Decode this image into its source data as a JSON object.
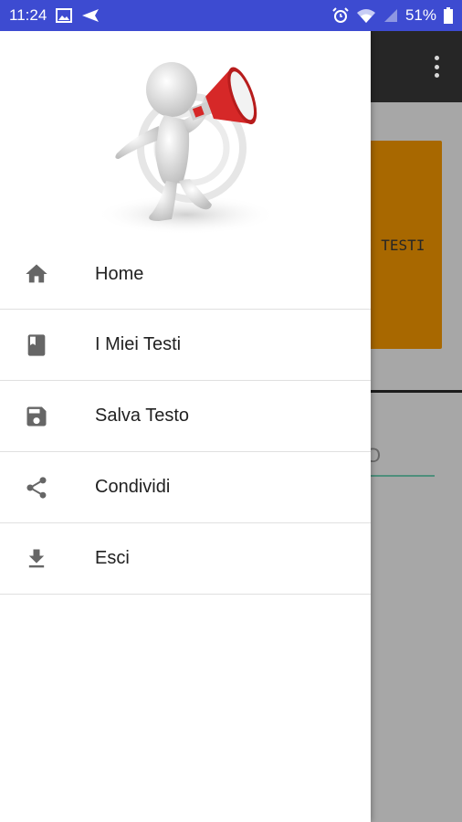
{
  "status_bar": {
    "time": "11:24",
    "battery": "51%",
    "icons": [
      "image-icon",
      "send-icon",
      "alarm-icon",
      "wifi-icon",
      "signal-icon",
      "battery-icon"
    ]
  },
  "app": {
    "card_text": "I TESTI",
    "input_hint": "O",
    "colors": {
      "toolbar": "#262626",
      "card": "#E08A00",
      "status_bar": "#3D4BD1"
    }
  },
  "drawer": {
    "header_image": "megaphone-man-illustration",
    "menu": [
      {
        "label": "Home",
        "icon": "home-icon"
      },
      {
        "label": "I Miei Testi",
        "icon": "book-icon"
      },
      {
        "label": "Salva Testo",
        "icon": "save-icon"
      },
      {
        "label": "Condividi",
        "icon": "share-icon"
      },
      {
        "label": "Esci",
        "icon": "download-icon"
      }
    ]
  }
}
